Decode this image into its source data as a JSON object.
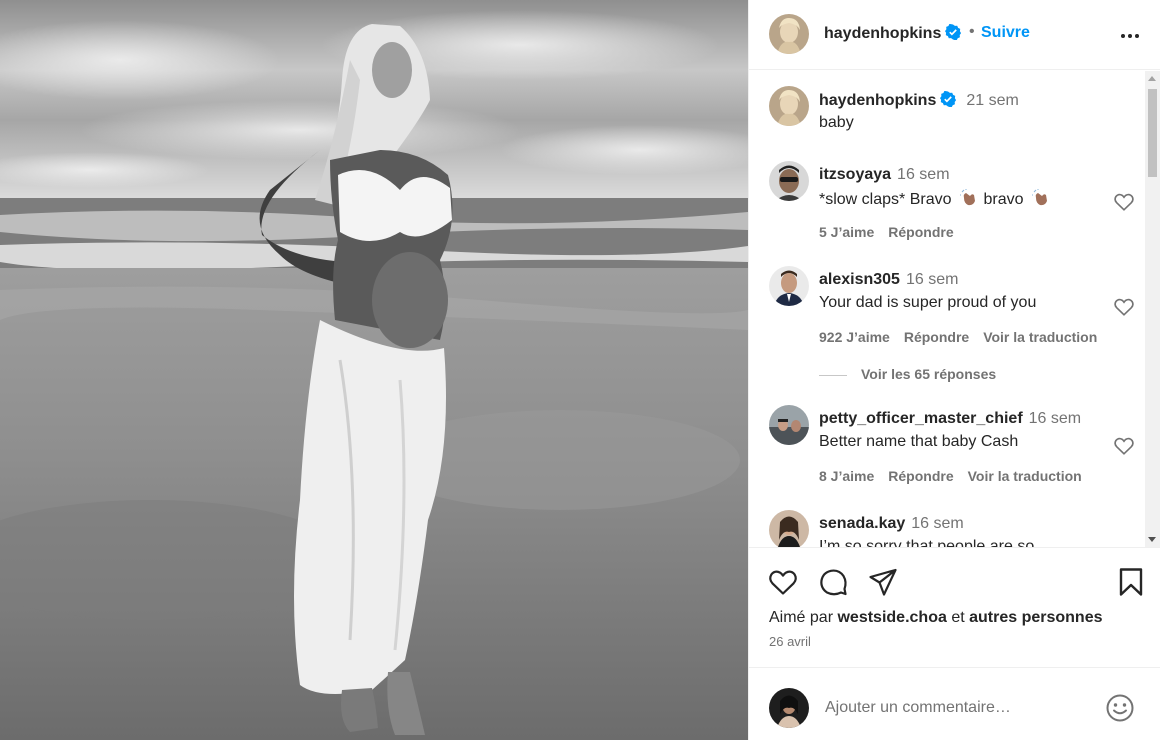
{
  "post": {
    "author": "haydenhopkins",
    "follow_label": "Suivre",
    "dot": "•",
    "caption": "baby",
    "caption_time": "21 sem"
  },
  "comments": [
    {
      "user": "itzsoyaya",
      "time": "16 sem",
      "text_before": "*slow claps* Bravo",
      "text_after": "bravo",
      "likes": "5 J’aime",
      "reply": "Répondre"
    },
    {
      "user": "alexisn305",
      "time": "16 sem",
      "text": "Your dad is super proud of you",
      "likes": "922 J’aime",
      "reply": "Répondre",
      "translate": "Voir la traduction"
    },
    {
      "user": "petty_officer_master_chief",
      "time": "16 sem",
      "text": "Better name that baby Cash",
      "likes": "8 J’aime",
      "reply": "Répondre",
      "translate": "Voir la traduction"
    },
    {
      "user": "senada.kay",
      "time": "16 sem",
      "text": "I’m so sorry that people are so"
    }
  ],
  "view_replies": "Voir les 65 réponses",
  "likes": {
    "prefix": "Aimé par",
    "user": "westside.choa",
    "connector": "et",
    "others": "autres personnes"
  },
  "date": "26 avril",
  "comment_input": {
    "placeholder": "Ajouter un commentaire…"
  },
  "colors": {
    "accent": "#0095f6",
    "verified": "#0095f6",
    "secondary_text": "#737373"
  },
  "icons": [
    "heart-icon",
    "comment-icon",
    "share-icon",
    "bookmark-icon",
    "emoji-icon",
    "more-icon",
    "verified-icon"
  ]
}
